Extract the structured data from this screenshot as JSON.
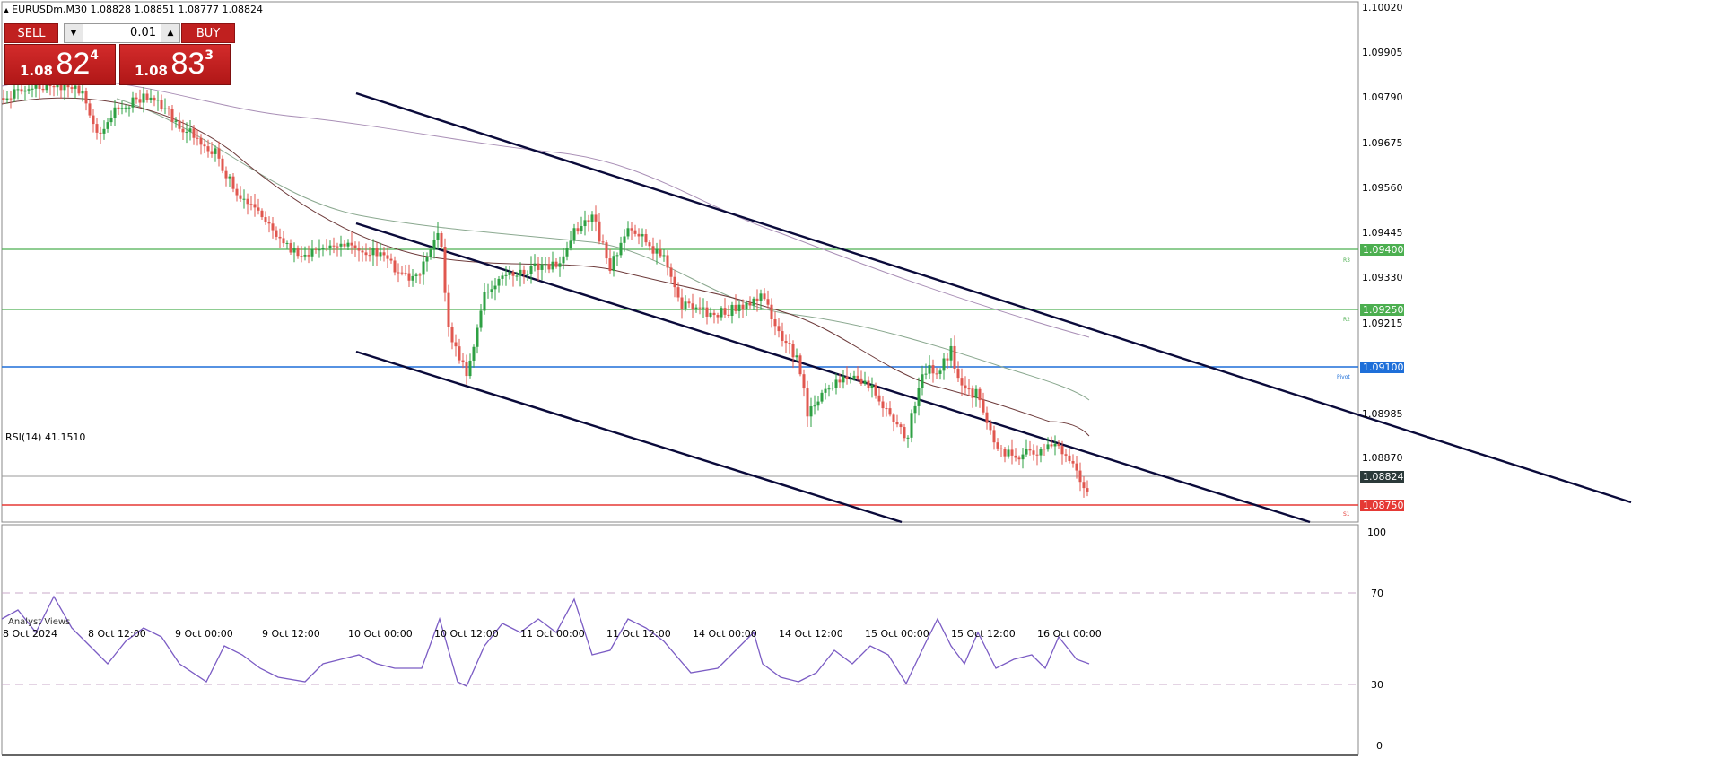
{
  "header": {
    "symbol_line": "EURUSDm,M30  1.08828 1.08851 1.08777 1.08824"
  },
  "trade_panel": {
    "sell_label": "SELL",
    "buy_label": "BUY",
    "volume": "0.01",
    "sell_price_prefix": "1.08",
    "sell_price_main": "82",
    "sell_price_sup": "4",
    "buy_price_prefix": "1.08",
    "buy_price_main": "83",
    "buy_price_sup": "3"
  },
  "price_axis": {
    "ticks": [
      "1.10020",
      "1.09905",
      "1.09790",
      "1.09675",
      "1.09560",
      "1.09445",
      "1.09330",
      "1.09215",
      "1.08985",
      "1.08870"
    ],
    "tags": {
      "r3": "1.09400",
      "r2": "1.09250",
      "pivot": "1.09100",
      "current": "1.08824",
      "s1": "1.08750"
    }
  },
  "levels": {
    "r3_label": "R3",
    "r2_label": "R2",
    "pivot_label": "Pivot",
    "s1_label": "S1"
  },
  "rsi": {
    "label": "RSI(14) 41.1510",
    "ticks": [
      "100",
      "70",
      "30",
      "0"
    ]
  },
  "time_axis": {
    "labels": [
      "8 Oct 2024",
      "8 Oct 12:00",
      "9 Oct 00:00",
      "9 Oct 12:00",
      "10 Oct 00:00",
      "10 Oct 12:00",
      "11 Oct 00:00",
      "11 Oct 12:00",
      "14 Oct 00:00",
      "14 Oct 12:00",
      "15 Oct 00:00",
      "15 Oct 12:00",
      "16 Oct 00:00"
    ]
  },
  "footer": {
    "analyst_views": "Analyst Views"
  },
  "colors": {
    "bull": "#2ea043",
    "bear": "#e0574f",
    "r_line": "#4caf50",
    "pivot": "#1e6fd9",
    "s1": "#e53935",
    "channel": "#0a0a3a",
    "rsi": "#7b5cc4"
  },
  "icons": {
    "symbol": "triangle-up-icon",
    "volume_down": "chevron-down-icon",
    "volume_up": "chevron-up-icon"
  }
}
